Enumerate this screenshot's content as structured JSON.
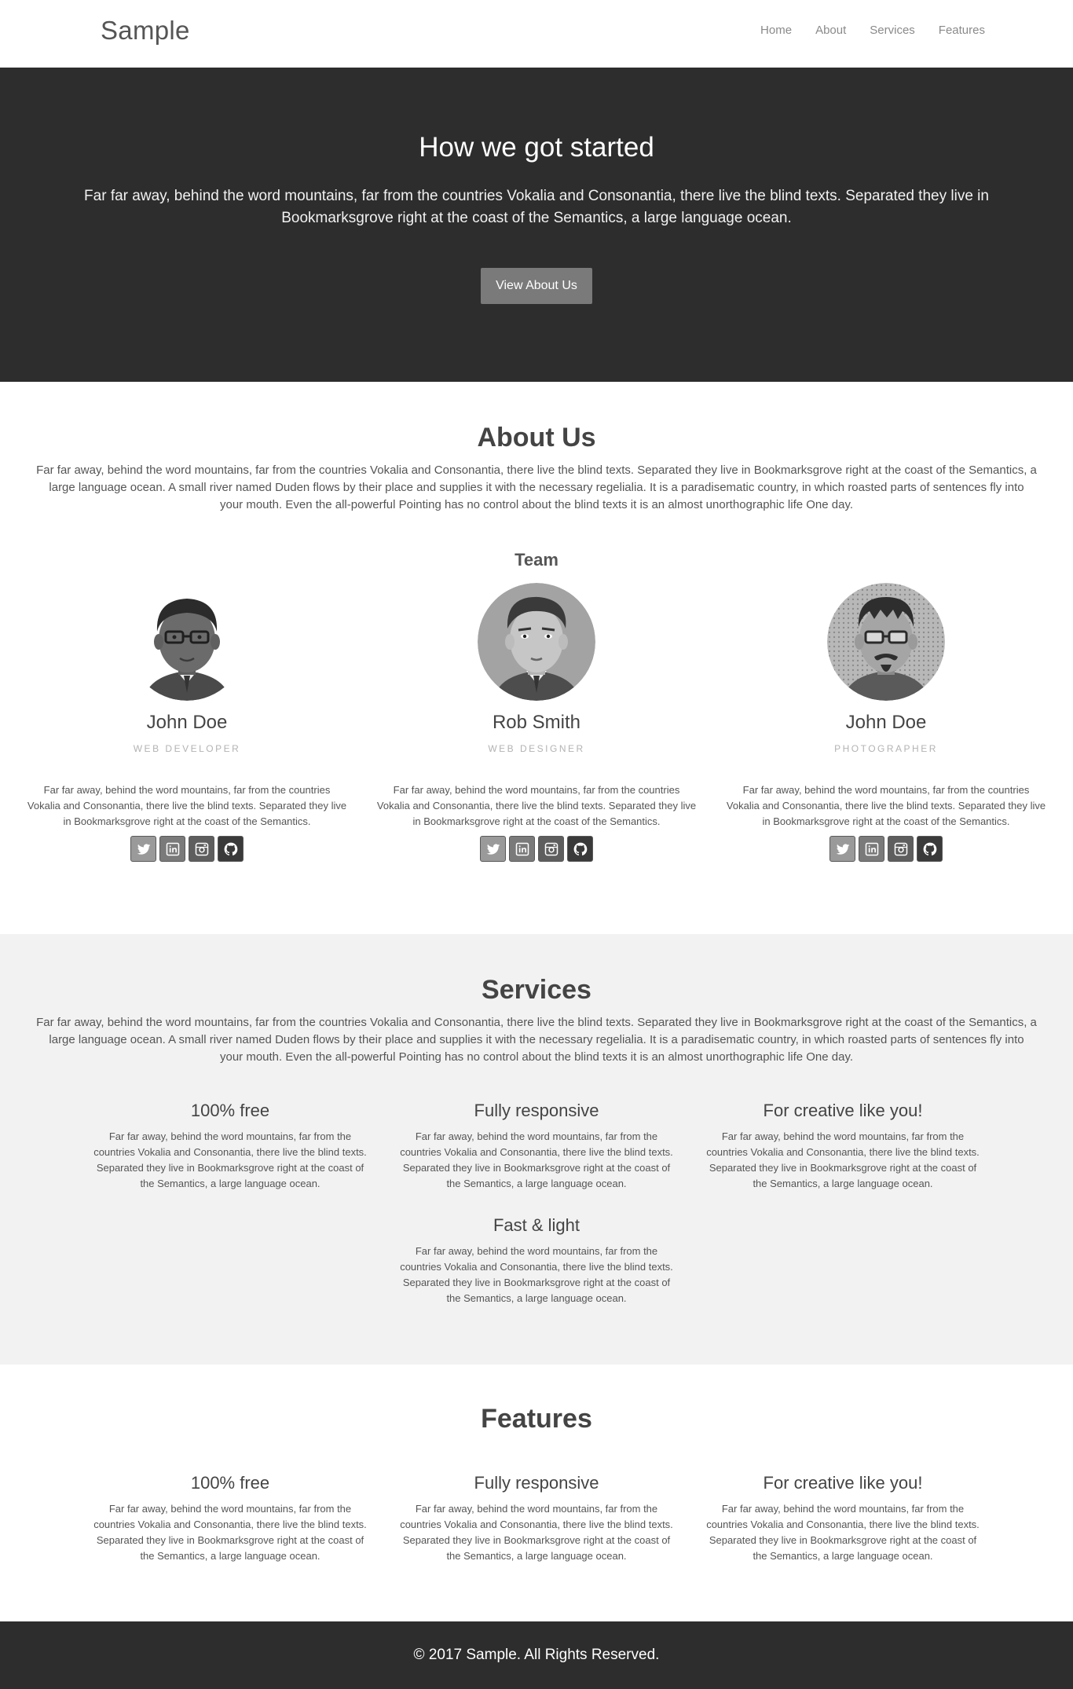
{
  "nav": {
    "brand": "Sample",
    "links": [
      "Home",
      "About",
      "Services",
      "Features"
    ]
  },
  "hero": {
    "title": "How we got started",
    "text": "Far far away, behind the word mountains, far from the countries Vokalia and Consonantia, there live the blind texts. Separated they live in Bookmarksgrove right at the coast of the Semantics, a large language ocean.",
    "button": "View About Us"
  },
  "about": {
    "title": "About Us",
    "text": "Far far away, behind the word mountains, far from the countries Vokalia and Consonantia, there live the blind texts. Separated they live in Bookmarksgrove right at the coast of the Semantics, a large language ocean. A small river named Duden flows by their place and supplies it with the necessary regelialia. It is a paradisematic country, in which roasted parts of sentences fly into your mouth. Even the all-powerful Pointing has no control about the blind texts it is an almost unorthographic life One day.",
    "team_title": "Team",
    "members": [
      {
        "name": "John Doe",
        "role": "WEB DEVELOPER",
        "bio": "Far far away, behind the word mountains, far from the countries Vokalia and Consonantia, there live the blind texts. Separated they live in Bookmarksgrove right at the coast of the Semantics."
      },
      {
        "name": "Rob Smith",
        "role": "WEB DESIGNER",
        "bio": "Far far away, behind the word mountains, far from the countries Vokalia and Consonantia, there live the blind texts. Separated they live in Bookmarksgrove right at the coast of the Semantics."
      },
      {
        "name": "John Doe",
        "role": "PHOTOGRAPHER",
        "bio": "Far far away, behind the word mountains, far from the countries Vokalia and Consonantia, there live the blind texts. Separated they live in Bookmarksgrove right at the coast of the Semantics."
      }
    ],
    "social_icons": [
      "twitter-icon",
      "linkedin-icon",
      "instagram-icon",
      "github-icon"
    ]
  },
  "services": {
    "title": "Services",
    "text": "Far far away, behind the word mountains, far from the countries Vokalia and Consonantia, there live the blind texts. Separated they live in Bookmarksgrove right at the coast of the Semantics, a large language ocean. A small river named Duden flows by their place and supplies it with the necessary regelialia. It is a paradisematic country, in which roasted parts of sentences fly into your mouth. Even the all-powerful Pointing has no control about the blind texts it is an almost unorthographic life One day.",
    "items": [
      {
        "title": "100% free",
        "text": "Far far away, behind the word mountains, far from the countries Vokalia and Consonantia, there live the blind texts. Separated they live in Bookmarksgrove right at the coast of the Semantics, a large language ocean."
      },
      {
        "title": "Fully responsive",
        "text": "Far far away, behind the word mountains, far from the countries Vokalia and Consonantia, there live the blind texts. Separated they live in Bookmarksgrove right at the coast of the Semantics, a large language ocean."
      },
      {
        "title": "For creative like you!",
        "text": "Far far away, behind the word mountains, far from the countries Vokalia and Consonantia, there live the blind texts. Separated they live in Bookmarksgrove right at the coast of the Semantics, a large language ocean."
      },
      {
        "title": "Fast & light",
        "text": "Far far away, behind the word mountains, far from the countries Vokalia and Consonantia, there live the blind texts. Separated they live in Bookmarksgrove right at the coast of the Semantics, a large language ocean."
      }
    ]
  },
  "features": {
    "title": "Features",
    "items": [
      {
        "title": "100% free",
        "text": "Far far away, behind the word mountains, far from the countries Vokalia and Consonantia, there live the blind texts. Separated they live in Bookmarksgrove right at the coast of the Semantics, a large language ocean."
      },
      {
        "title": "Fully responsive",
        "text": "Far far away, behind the word mountains, far from the countries Vokalia and Consonantia, there live the blind texts. Separated they live in Bookmarksgrove right at the coast of the Semantics, a large language ocean."
      },
      {
        "title": "For creative like you!",
        "text": "Far far away, behind the word mountains, far from the countries Vokalia and Consonantia, there live the blind texts. Separated they live in Bookmarksgrove right at the coast of the Semantics, a large language ocean."
      }
    ]
  },
  "footer": {
    "text": "© 2017 Sample. All Rights Reserved."
  }
}
